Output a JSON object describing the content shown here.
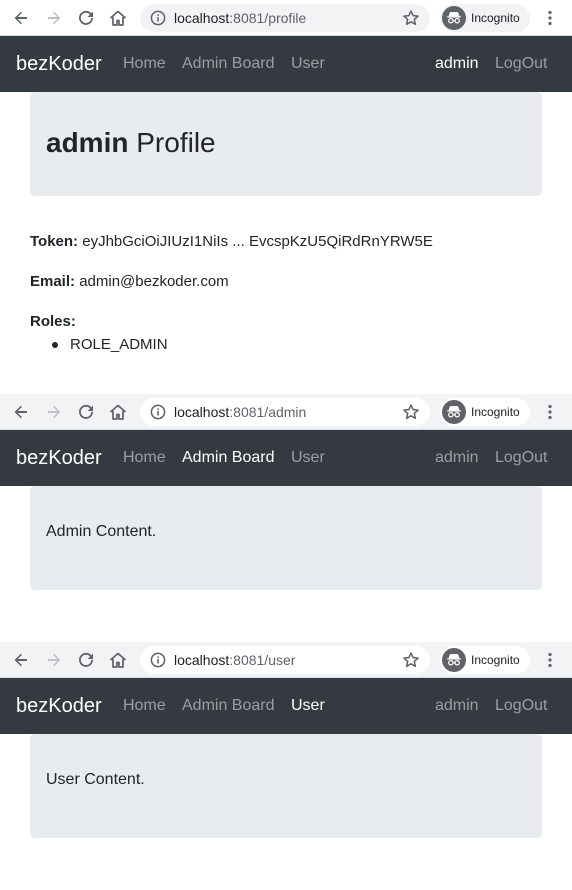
{
  "app": {
    "brand": "bezKoder"
  },
  "nav": {
    "home": "Home",
    "admin_board": "Admin Board",
    "user": "User",
    "current_user": "admin",
    "logout": "LogOut"
  },
  "browser": {
    "incognito_label": "Incognito"
  },
  "icons": [
    "back-icon",
    "forward-icon",
    "reload-icon",
    "home-icon",
    "info-icon",
    "star-icon",
    "incognito-icon",
    "menu-icon"
  ],
  "colors": {
    "navbar": "#343a40",
    "jumbotron": "#e9ecef",
    "nav_active": "#ffffff",
    "nav_inactive": "rgba(255,255,255,0.5)"
  },
  "screens": [
    {
      "url_host": "localhost",
      "url_path": ":8081/profile",
      "active_nav": "current_user",
      "profile": {
        "username": "admin",
        "title_suffix": "Profile",
        "token_label": "Token:",
        "token_value": "eyJhbGciOiJIUzI1NiIs ... EvcspKzU5QiRdRnYRW5E",
        "email_label": "Email:",
        "email_value": "admin@bezkoder.com",
        "roles_label": "Roles:",
        "roles": [
          "ROLE_ADMIN"
        ]
      }
    },
    {
      "url_host": "localhost",
      "url_path": ":8081/admin",
      "active_nav": "admin_board",
      "content": "Admin Content."
    },
    {
      "url_host": "localhost",
      "url_path": ":8081/user",
      "active_nav": "user",
      "content": "User Content."
    }
  ]
}
